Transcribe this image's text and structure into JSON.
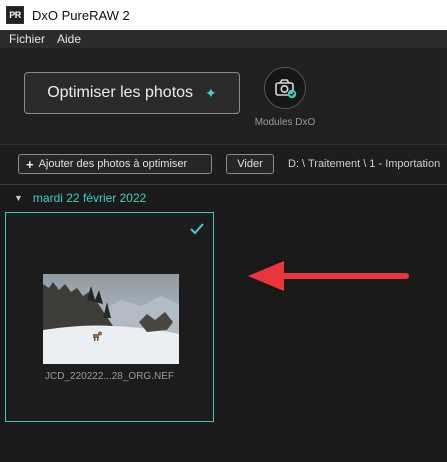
{
  "window": {
    "logo_text": "PR",
    "title": "DxO PureRAW 2"
  },
  "menu": [
    {
      "label": "Fichier"
    },
    {
      "label": "Aide"
    }
  ],
  "toolbar": {
    "optimise_label": "Optimiser les photos",
    "modules_label": "Modules DxO"
  },
  "actions": {
    "add_label": "Ajouter des photos à optimiser",
    "clear_label": "Vider",
    "path": "D: \\ Traitement \\ 1 - Importation"
  },
  "group": {
    "date_label": "mardi 22 février 2022"
  },
  "photos": [
    {
      "filename": "JCD_220222...28_ORG.NEF",
      "selected": true
    }
  ],
  "colors": {
    "accent": "#3fcfc0",
    "annotation_arrow": "#e8363a"
  },
  "icons": [
    "sparkle-icon",
    "camera-icon",
    "check-icon",
    "plus-icon",
    "triangle-down-icon",
    "arrow-left-icon"
  ]
}
